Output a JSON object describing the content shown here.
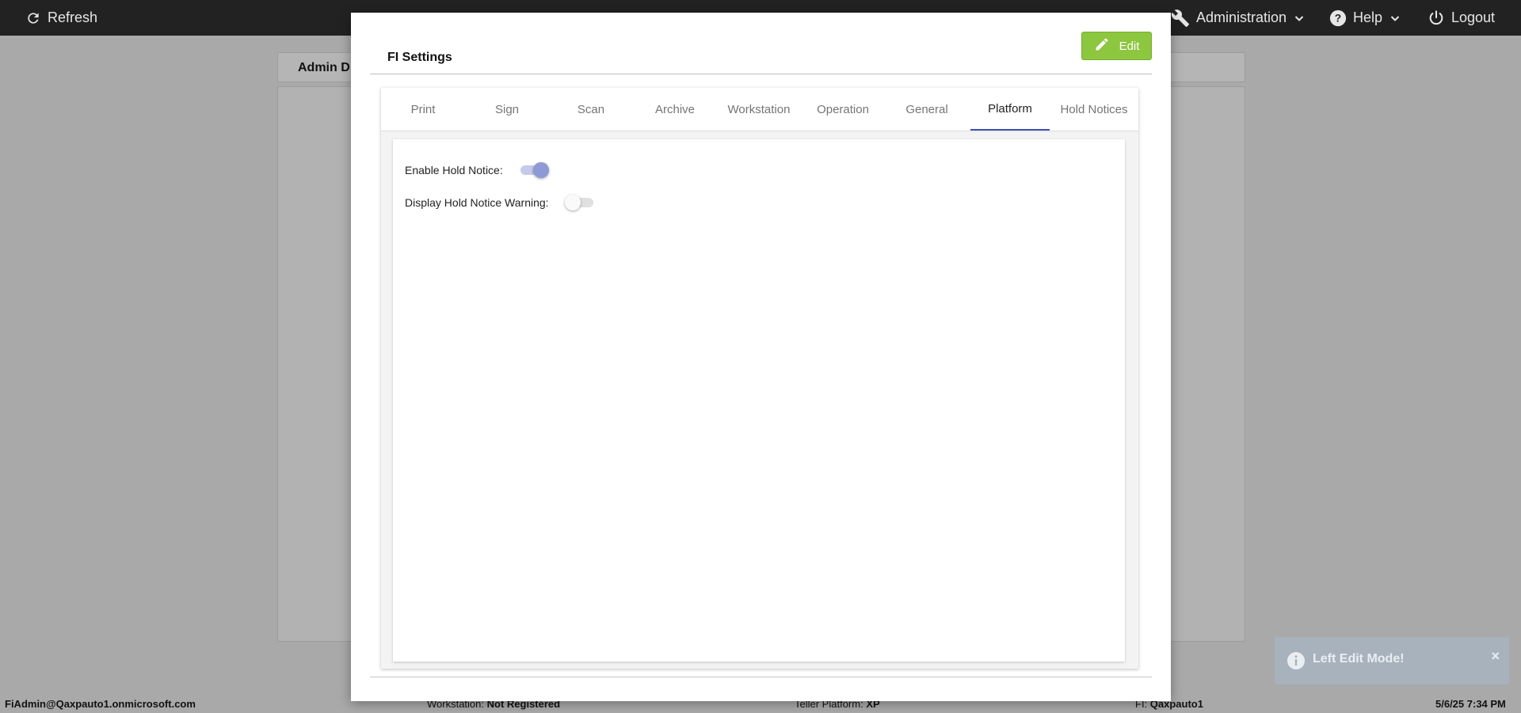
{
  "topbar": {
    "refresh_label": "Refresh",
    "administration_label": "Administration",
    "help_label": "Help",
    "logout_label": "Logout"
  },
  "background": {
    "card_title": "Admin D"
  },
  "modal": {
    "title": "FI Settings",
    "edit_label": "Edit",
    "tabs": [
      {
        "label": "Print"
      },
      {
        "label": "Sign"
      },
      {
        "label": "Scan"
      },
      {
        "label": "Archive"
      },
      {
        "label": "Workstation"
      },
      {
        "label": "Operation"
      },
      {
        "label": "General"
      },
      {
        "label": "Platform"
      },
      {
        "label": "Hold Notices"
      }
    ],
    "active_tab": "Platform",
    "fields": [
      {
        "label": "Enable Hold Notice:",
        "enabled": true
      },
      {
        "label": "Display Hold Notice Warning:",
        "enabled": false
      }
    ]
  },
  "statusbar": {
    "user": "FiAdmin@Qaxpauto1.onmicrosoft.com",
    "workstation_label": "Workstation:",
    "workstation_value": "Not Registered",
    "teller_label": "Teller Platform:",
    "teller_value": "XP",
    "fi_label": "FI:",
    "fi_value": "Qaxpauto1",
    "datetime": "5/6/25 7:34 PM"
  },
  "toast": {
    "message": "Left Edit Mode!",
    "close_glyph": "×"
  },
  "colors": {
    "topbar": "#222222",
    "edit_button": "#8dc63f",
    "active_tab_underline": "#3f51b5",
    "switch_on": "#8e99d6",
    "toast": "#a8b2bd"
  }
}
